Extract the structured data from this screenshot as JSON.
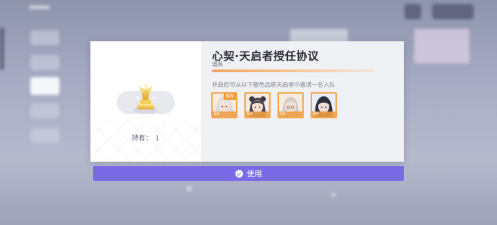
{
  "item": {
    "name": "心契·天启者授任协议",
    "category": "道具",
    "hold_label": "持有：",
    "hold_count": "1",
    "description": "开启后可从以下橙色品质天启者中邀请一名入队",
    "icon": "golden-trophy-icon"
  },
  "characters": [
    {
      "level": "60",
      "badge": "推荐"
    },
    {
      "level": "60",
      "badge": ""
    },
    {
      "level": "60",
      "badge": ""
    },
    {
      "level": "60",
      "badge": ""
    }
  ],
  "actions": {
    "use_label": "使用"
  },
  "colors": {
    "accent": "#7a6ae6",
    "quality_orange": "#f2a64e",
    "progress_orange": "#f2a35d"
  }
}
